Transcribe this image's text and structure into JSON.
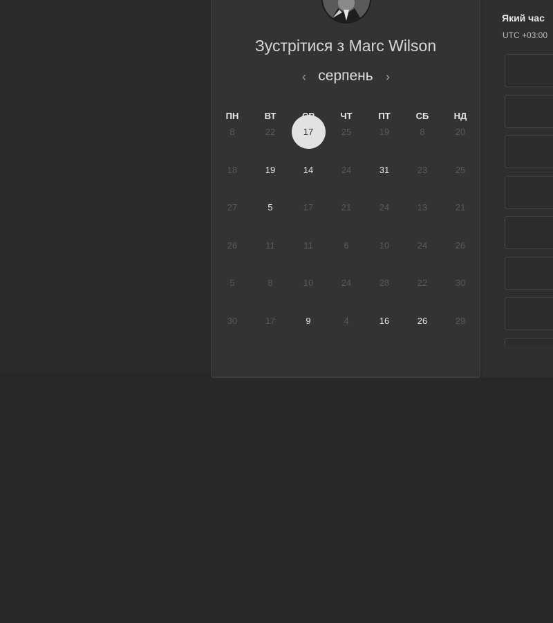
{
  "header": {
    "title": "Зустрітися з Marc Wilson"
  },
  "calendar": {
    "month": "серпень",
    "prev_icon": "chevron-left-icon",
    "next_icon": "chevron-right-icon",
    "weekdays": [
      "ПН",
      "ВТ",
      "СР",
      "ЧТ",
      "ПТ",
      "СБ",
      "НД"
    ],
    "selected_day": "17",
    "weeks": [
      [
        {
          "d": "8",
          "available": false
        },
        {
          "d": "22",
          "available": false
        },
        {
          "d": "17",
          "available": true,
          "selected": true
        },
        {
          "d": "25",
          "available": false
        },
        {
          "d": "19",
          "available": false
        },
        {
          "d": "8",
          "available": false
        },
        {
          "d": "20",
          "available": false
        }
      ],
      [
        {
          "d": "18",
          "available": false
        },
        {
          "d": "19",
          "available": true
        },
        {
          "d": "14",
          "available": true
        },
        {
          "d": "24",
          "available": false
        },
        {
          "d": "31",
          "available": true
        },
        {
          "d": "23",
          "available": false
        },
        {
          "d": "25",
          "available": false
        }
      ],
      [
        {
          "d": "27",
          "available": false
        },
        {
          "d": "5",
          "available": true
        },
        {
          "d": "17",
          "available": false
        },
        {
          "d": "21",
          "available": false
        },
        {
          "d": "24",
          "available": false
        },
        {
          "d": "13",
          "available": false
        },
        {
          "d": "21",
          "available": false
        }
      ],
      [
        {
          "d": "26",
          "available": false
        },
        {
          "d": "11",
          "available": false
        },
        {
          "d": "11",
          "available": false
        },
        {
          "d": "6",
          "available": false
        },
        {
          "d": "10",
          "available": false
        },
        {
          "d": "24",
          "available": false
        },
        {
          "d": "26",
          "available": false
        }
      ],
      [
        {
          "d": "5",
          "available": false
        },
        {
          "d": "8",
          "available": false
        },
        {
          "d": "10",
          "available": false
        },
        {
          "d": "24",
          "available": false
        },
        {
          "d": "28",
          "available": false
        },
        {
          "d": "22",
          "available": false
        },
        {
          "d": "30",
          "available": false
        }
      ],
      [
        {
          "d": "30",
          "available": false
        },
        {
          "d": "17",
          "available": false
        },
        {
          "d": "9",
          "available": true
        },
        {
          "d": "4",
          "available": false
        },
        {
          "d": "16",
          "available": true
        },
        {
          "d": "26",
          "available": true
        },
        {
          "d": "29",
          "available": false
        }
      ]
    ]
  },
  "time_panel": {
    "question": "Який час",
    "timezone": "UTC +03:00"
  },
  "colors": {
    "background": "#282828",
    "card": "#333333",
    "selected_circle": "#e2e2e2",
    "available_text": "#e8e8e8",
    "unavailable_text": "#595959"
  }
}
